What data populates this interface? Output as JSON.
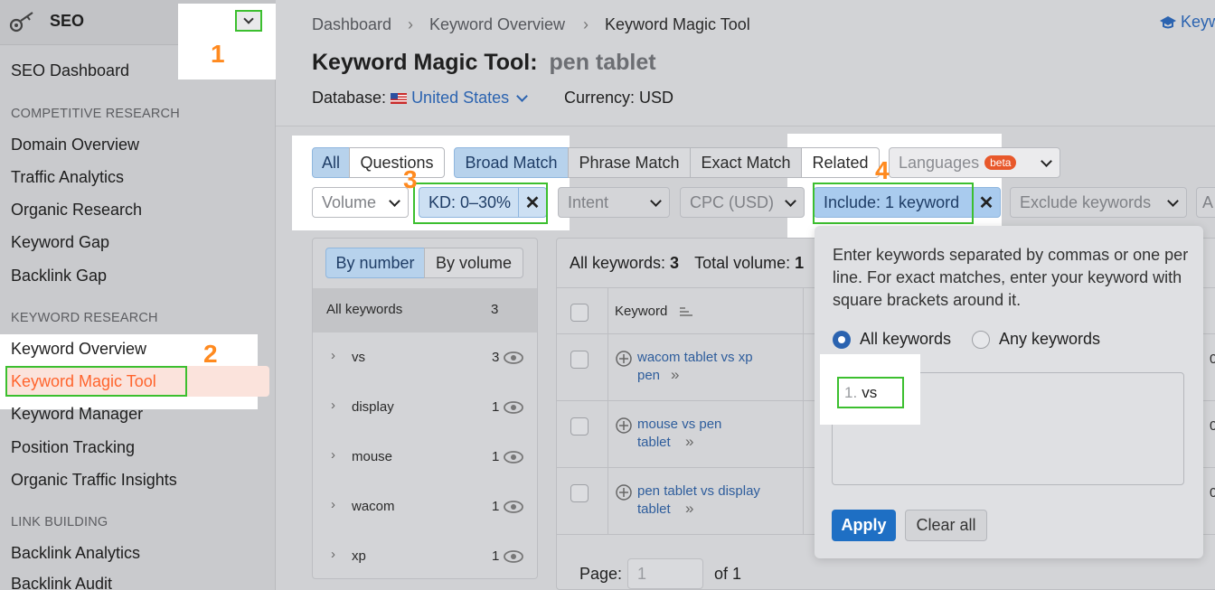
{
  "sidebar": {
    "section_title": "SEO",
    "items": {
      "dashboard": "SEO Dashboard",
      "competitive_header": "COMPETITIVE RESEARCH",
      "domain_overview": "Domain Overview",
      "traffic_analytics": "Traffic Analytics",
      "organic_research": "Organic Research",
      "keyword_gap": "Keyword Gap",
      "backlink_gap": "Backlink Gap",
      "keyword_research_header": "KEYWORD RESEARCH",
      "keyword_overview": "Keyword Overview",
      "keyword_magic_tool": "Keyword Magic Tool",
      "keyword_manager": "Keyword Manager",
      "position_tracking": "Position Tracking",
      "organic_traffic_insights": "Organic Traffic Insights",
      "link_building_header": "LINK BUILDING",
      "backlink_analytics": "Backlink Analytics",
      "backlink_audit": "Backlink Audit"
    }
  },
  "breadcrumb": {
    "dashboard": "Dashboard",
    "keyword_overview": "Keyword Overview",
    "current": "Keyword Magic Tool",
    "right_link": "Keyw"
  },
  "page": {
    "title": "Keyword Magic Tool:",
    "query": "pen tablet",
    "database_label": "Database:",
    "database_value": "United States",
    "currency": "Currency: USD"
  },
  "match_tabs": {
    "all": "All",
    "questions": "Questions",
    "broad": "Broad Match",
    "phrase": "Phrase Match",
    "exact": "Exact Match",
    "related": "Related",
    "languages": "Languages",
    "beta": "beta"
  },
  "filters": {
    "volume": "Volume",
    "kd": "KD: 0–30%",
    "intent": "Intent",
    "cpc": "CPC (USD)",
    "include": "Include: 1 keyword",
    "exclude": "Exclude keywords",
    "overflow": "A"
  },
  "groups": {
    "by_number": "By number",
    "by_volume": "By volume",
    "all_label": "All keywords",
    "all_count": "3",
    "rows": [
      {
        "name": "vs",
        "count": "3"
      },
      {
        "name": "display",
        "count": "1"
      },
      {
        "name": "mouse",
        "count": "1"
      },
      {
        "name": "wacom",
        "count": "1"
      },
      {
        "name": "xp",
        "count": "1"
      }
    ]
  },
  "table": {
    "summary_label": "All keywords:",
    "summary_count": "3",
    "volume_label": "Total volume:",
    "volume_value": "1",
    "col_keyword": "Keyword",
    "rows": [
      {
        "line1": "wacom tablet vs xp",
        "line2": "pen",
        "right": "0"
      },
      {
        "line1": "mouse vs pen",
        "line2": "tablet",
        "right": "0"
      },
      {
        "line1": "pen tablet vs display",
        "line2": "tablet",
        "right": "0"
      }
    ],
    "page_label": "Page:",
    "page_value": "1",
    "page_of": "of 1"
  },
  "include_popover": {
    "instructions": "Enter keywords separated by commas or one per line. For exact matches, enter your keyword with square brackets around it.",
    "opt_all": "All keywords",
    "opt_any": "Any keywords",
    "line_no": "1.",
    "line_text": "vs",
    "apply": "Apply",
    "clear": "Clear all"
  },
  "callouts": {
    "n1": "1",
    "n2": "2",
    "n3": "3",
    "n4": "4"
  },
  "colors": {
    "accent": "#2b63b0",
    "callout": "#ff8a1f",
    "highlight_box": "#3cbf2f",
    "active_nav": "#ff642d"
  }
}
